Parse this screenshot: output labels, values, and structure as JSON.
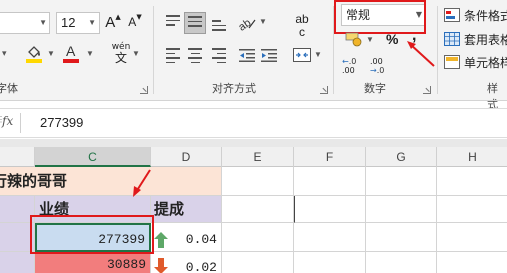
{
  "ribbon": {
    "font": {
      "size": "12",
      "grow_icon": "A",
      "shrink_icon": "A",
      "group_label_partial": "字体"
    },
    "alignment": {
      "group_label": "对齐方式",
      "wrap_text_label": "ab",
      "wrap_text_sub": "c"
    },
    "number": {
      "format_value": "常规",
      "group_label": "数字",
      "percent": "%",
      "comma": ",",
      "inc_decimal": ".00",
      "dec_decimal": ".0"
    },
    "styles": {
      "group_label_partial": "样式",
      "conditional_format": "条件格式",
      "format_as_table": "套用表格",
      "cell_styles": "单元格样"
    }
  },
  "formula_bar": {
    "fx_label": "fx",
    "value": "277399"
  },
  "columns": [
    "C",
    "D",
    "E",
    "F",
    "G",
    "H"
  ],
  "sheet": {
    "title": "行辣的哥哥",
    "headers": {
      "c": "业绩",
      "d": "提成"
    },
    "rows": [
      {
        "sales": "277399",
        "commission": "0.04",
        "trend": "up"
      },
      {
        "sales": "30889",
        "commission": "0.02",
        "trend": "down"
      }
    ]
  },
  "colors": {
    "accent_red": "#e0191b",
    "excel_green": "#217346",
    "title_fill": "#fce4d6",
    "header_fill": "#d9d2e9",
    "selected_fill": "#c9dcf0",
    "low_fill": "#f27d7d",
    "up_arrow": "#5ea868",
    "down_arrow": "#e05a2b"
  }
}
